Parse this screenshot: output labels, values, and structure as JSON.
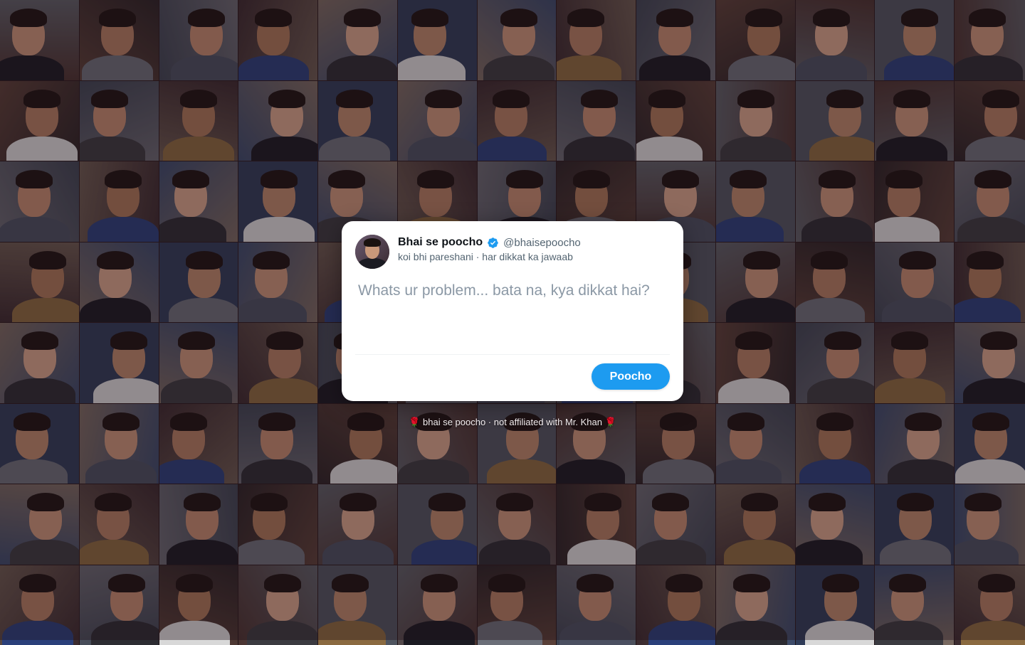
{
  "card": {
    "display_name": "Bhai se poocho",
    "verified_icon": "verified-badge-icon",
    "handle": "@bhaisepoocho",
    "tagline": "koi bhi pareshani · har dikkat ka jawaab",
    "input_placeholder": "Whats ur problem... bata na, kya dikkat hai?",
    "input_value": "",
    "submit_label": "Poocho",
    "accent_color": "#1d9bf0"
  },
  "footer": {
    "rose_icon": "rose-icon",
    "rose_glyph": "🌹",
    "text": "bhai se poocho · not affiliated with Mr. Khan"
  },
  "background": {
    "description_icon": "photo-collage",
    "tile_count": 104
  }
}
